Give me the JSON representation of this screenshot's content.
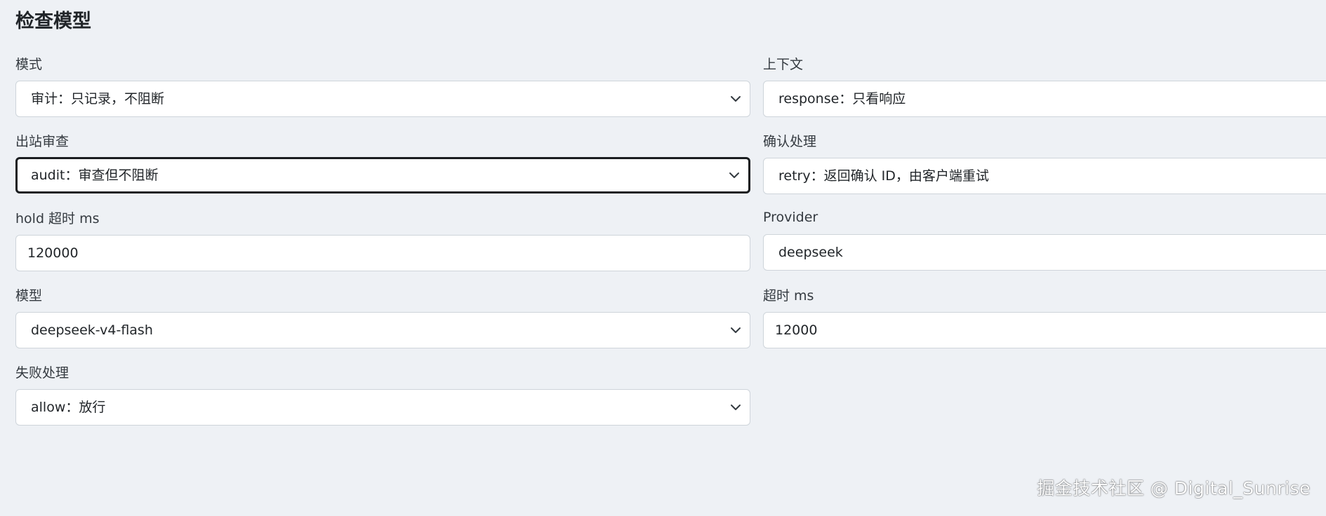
{
  "title": "检查模型",
  "fields": {
    "mode": {
      "label": "模式",
      "value": "审计：只记录，不阻断"
    },
    "context": {
      "label": "上下文",
      "value": "response：只看响应"
    },
    "outbound": {
      "label": "出站审查",
      "value": "audit：审查但不阻断"
    },
    "confirm": {
      "label": "确认处理",
      "value": "retry：返回确认 ID，由客户端重试"
    },
    "hold_timeout": {
      "label": "hold 超时 ms",
      "value": "120000"
    },
    "provider": {
      "label": "Provider",
      "value": "deepseek"
    },
    "model": {
      "label": "模型",
      "value": "deepseek-v4-flash"
    },
    "timeout": {
      "label": "超时 ms",
      "value": "12000"
    },
    "failure": {
      "label": "失败处理",
      "value": "allow：放行"
    }
  },
  "watermark": "掘金技术社区 @ Digital_Sunrise",
  "icons": {
    "select_arrow": "chevron-down-icon"
  },
  "colors": {
    "background": "#eef1f5",
    "focus_border": "#1a1d20",
    "border": "#ced4da"
  }
}
